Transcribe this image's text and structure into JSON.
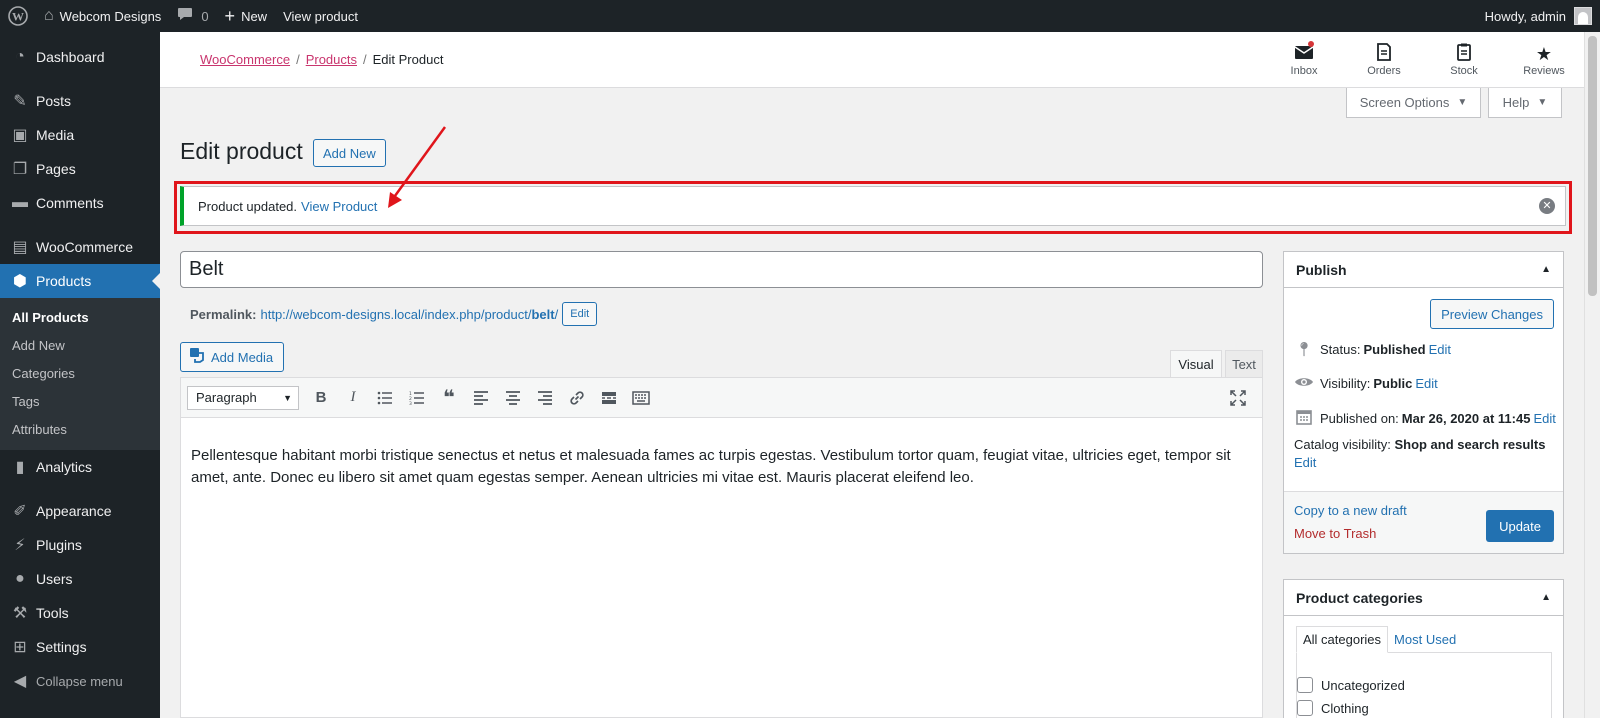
{
  "admin_bar": {
    "site_name": "Webcom Designs",
    "comments_count": "0",
    "new_label": "New",
    "view_product_label": "View product",
    "howdy": "Howdy, admin"
  },
  "sidebar": {
    "dashboard": "Dashboard",
    "posts": "Posts",
    "media": "Media",
    "pages": "Pages",
    "comments": "Comments",
    "woocommerce": "WooCommerce",
    "products": "Products",
    "submenu": [
      "All Products",
      "Add New",
      "Categories",
      "Tags",
      "Attributes"
    ],
    "analytics": "Analytics",
    "appearance": "Appearance",
    "plugins": "Plugins",
    "users": "Users",
    "tools": "Tools",
    "settings": "Settings",
    "collapse": "Collapse menu"
  },
  "header": {
    "breadcrumb": [
      "WooCommerce",
      "Products",
      "Edit Product"
    ],
    "actions": [
      "Inbox",
      "Orders",
      "Stock",
      "Reviews"
    ]
  },
  "screen_options": "Screen Options",
  "help": "Help",
  "page_title": "Edit product",
  "add_new": "Add New",
  "notice": {
    "message": "Product updated.",
    "link": "View Product"
  },
  "product": {
    "title": "Belt",
    "permalink_label": "Permalink:",
    "permalink_base": "http://webcom-designs.local/index.php/product/",
    "permalink_slug": "belt",
    "permalink_end": "/",
    "edit_label": "Edit"
  },
  "editor": {
    "add_media": "Add Media",
    "tab_visual": "Visual",
    "tab_text": "Text",
    "format": "Paragraph",
    "content": "Pellentesque habitant morbi tristique senectus et netus et malesuada fames ac turpis egestas. Vestibulum tortor quam, feugiat vitae, ultricies eget, tempor sit amet, ante. Donec eu libero sit amet quam egestas semper. Aenean ultricies mi vitae est. Mauris placerat eleifend leo."
  },
  "publish": {
    "title": "Publish",
    "preview": "Preview Changes",
    "status_label": "Status:",
    "status_value": "Published",
    "visibility_label": "Visibility:",
    "visibility_value": "Public",
    "published_label": "Published on:",
    "published_value": "Mar 26, 2020 at 11:45",
    "catalog_label": "Catalog visibility:",
    "catalog_value": "Shop and search results",
    "edit": "Edit",
    "copy_draft": "Copy to a new draft",
    "trash": "Move to Trash",
    "update": "Update"
  },
  "categories": {
    "title": "Product categories",
    "tab_all": "All categories",
    "tab_most": "Most Used",
    "items": [
      "Uncategorized",
      "Clothing"
    ]
  },
  "colors": {
    "accent": "#2271b1",
    "admin_dark": "#1d2327",
    "success": "#00a32a",
    "highlight": "#e0151b",
    "woo_link": "#c9356e"
  }
}
